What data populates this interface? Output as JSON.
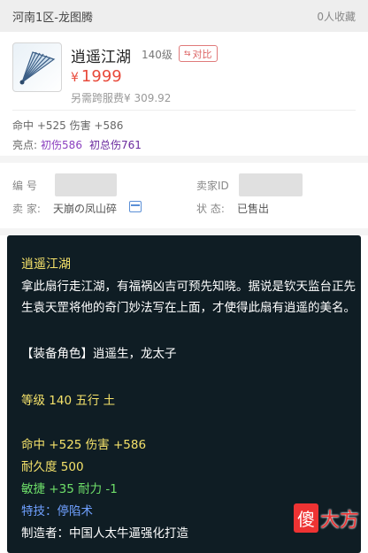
{
  "header": {
    "server": "河南1区-龙图腾",
    "favorites": "0人收藏"
  },
  "item": {
    "name": "逍遥江湖",
    "level": "140级",
    "compare_label": "对比",
    "compare_icon": "compare-icon",
    "price_currency": "¥",
    "price": "1999",
    "cross_server_fee": "另需跨服费¥ 309.92",
    "stats": "命中 +525 伤害 +586",
    "highlight_label": "亮点:",
    "highlight_1": "初伤586",
    "highlight_2": "初总伤761"
  },
  "seller": {
    "id_label": "编 号",
    "seller_id_label": "卖家ID",
    "seller_label": "卖 家:",
    "seller_name": "天崩の凤山碎",
    "status_label": "状 态:",
    "status_value": "已售出"
  },
  "description": {
    "title": "逍遥江湖",
    "text": "拿此扇行走江湖，有福祸凶吉可预先知晓。据说是钦天监台正先生袁天罡将他的奇门妙法写在上面，才使得此扇有逍遥的美名。",
    "role": "【装备角色】逍遥生，龙太子",
    "level_line": "等级 140 五行 土",
    "hit_line": "命中 +525 伤害 +586",
    "durability": "耐久度 500",
    "agility": "敏捷 +35 耐力 -1",
    "skill": "特技：停陷术",
    "maker": "制造者：中国人太牛逼强化打造"
  },
  "watermark": {
    "part1": "傻",
    "part2": "大方"
  },
  "colors": {
    "price": "#e84a3b",
    "desc_bg": "#0f1d24",
    "title": "#f5e26a",
    "green": "#6fe06a",
    "blue": "#6fa0ff"
  }
}
